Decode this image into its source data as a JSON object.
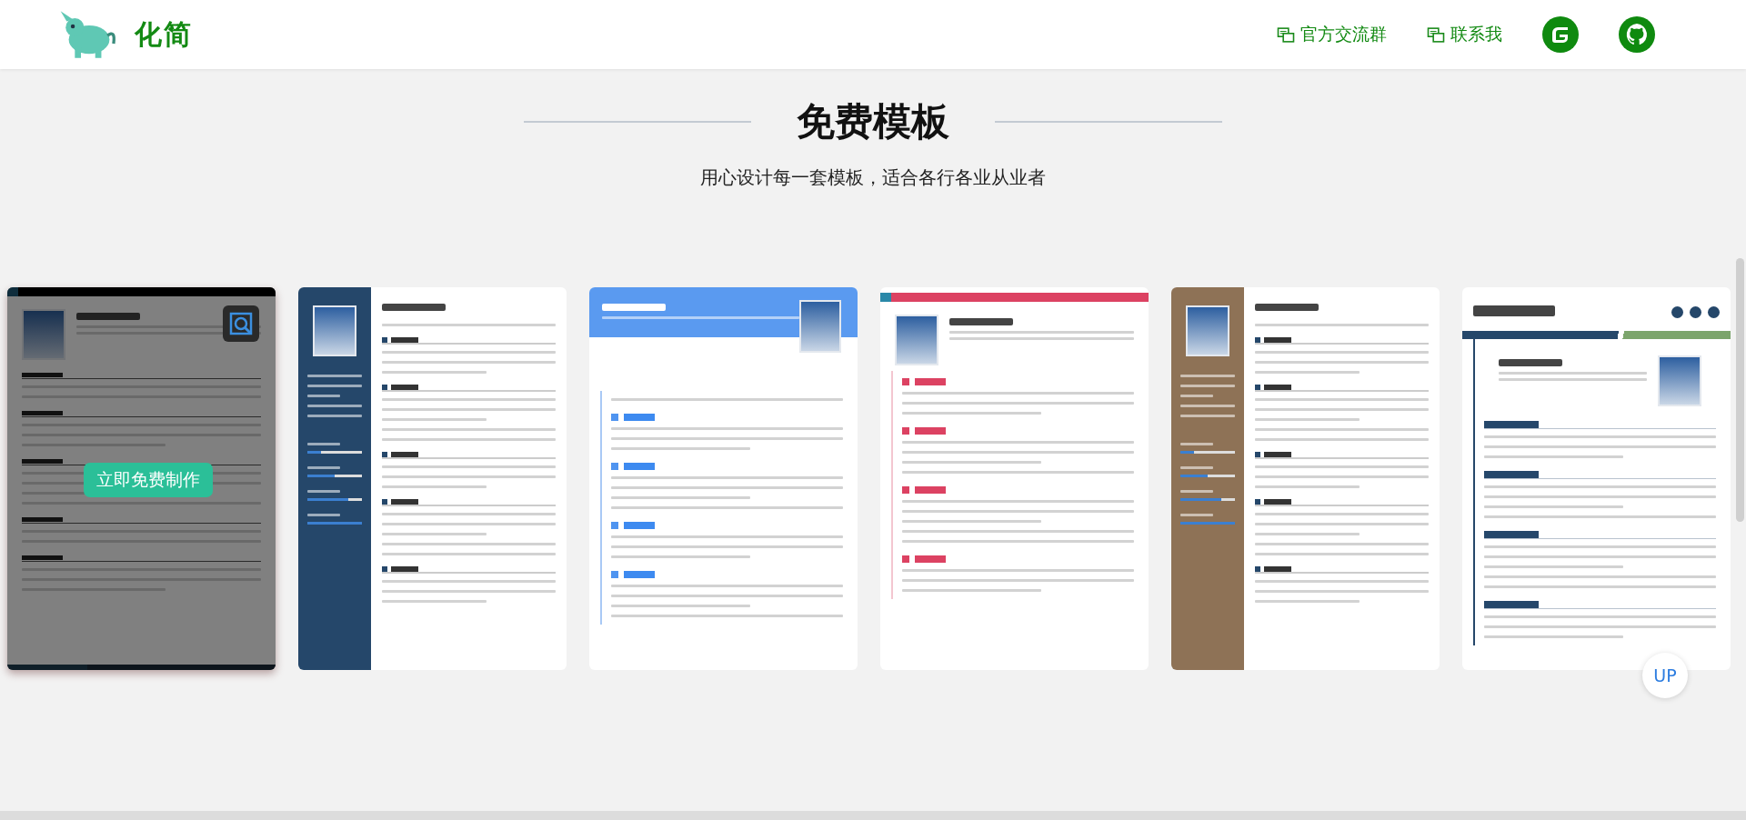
{
  "header": {
    "brand": "化简",
    "nav": [
      {
        "kind": "chat",
        "label": "官方交流群"
      },
      {
        "kind": "chat",
        "label": "联系我"
      },
      {
        "kind": "gitee"
      },
      {
        "kind": "github"
      }
    ]
  },
  "section": {
    "title": "免费模板",
    "subtitle": "用心设计每一套模板，适合各行各业从业者"
  },
  "hover_action": {
    "label": "立即免费制作"
  },
  "templates": [
    {
      "kind": "topbar",
      "hovered": true
    },
    {
      "kind": "sidebar-navy",
      "hovered": false
    },
    {
      "kind": "wave",
      "hovered": false
    },
    {
      "kind": "timeline",
      "hovered": false
    },
    {
      "kind": "sidebar-brown",
      "hovered": false
    },
    {
      "kind": "banner",
      "hovered": false
    }
  ],
  "back_to_top": {
    "label": "UP"
  }
}
